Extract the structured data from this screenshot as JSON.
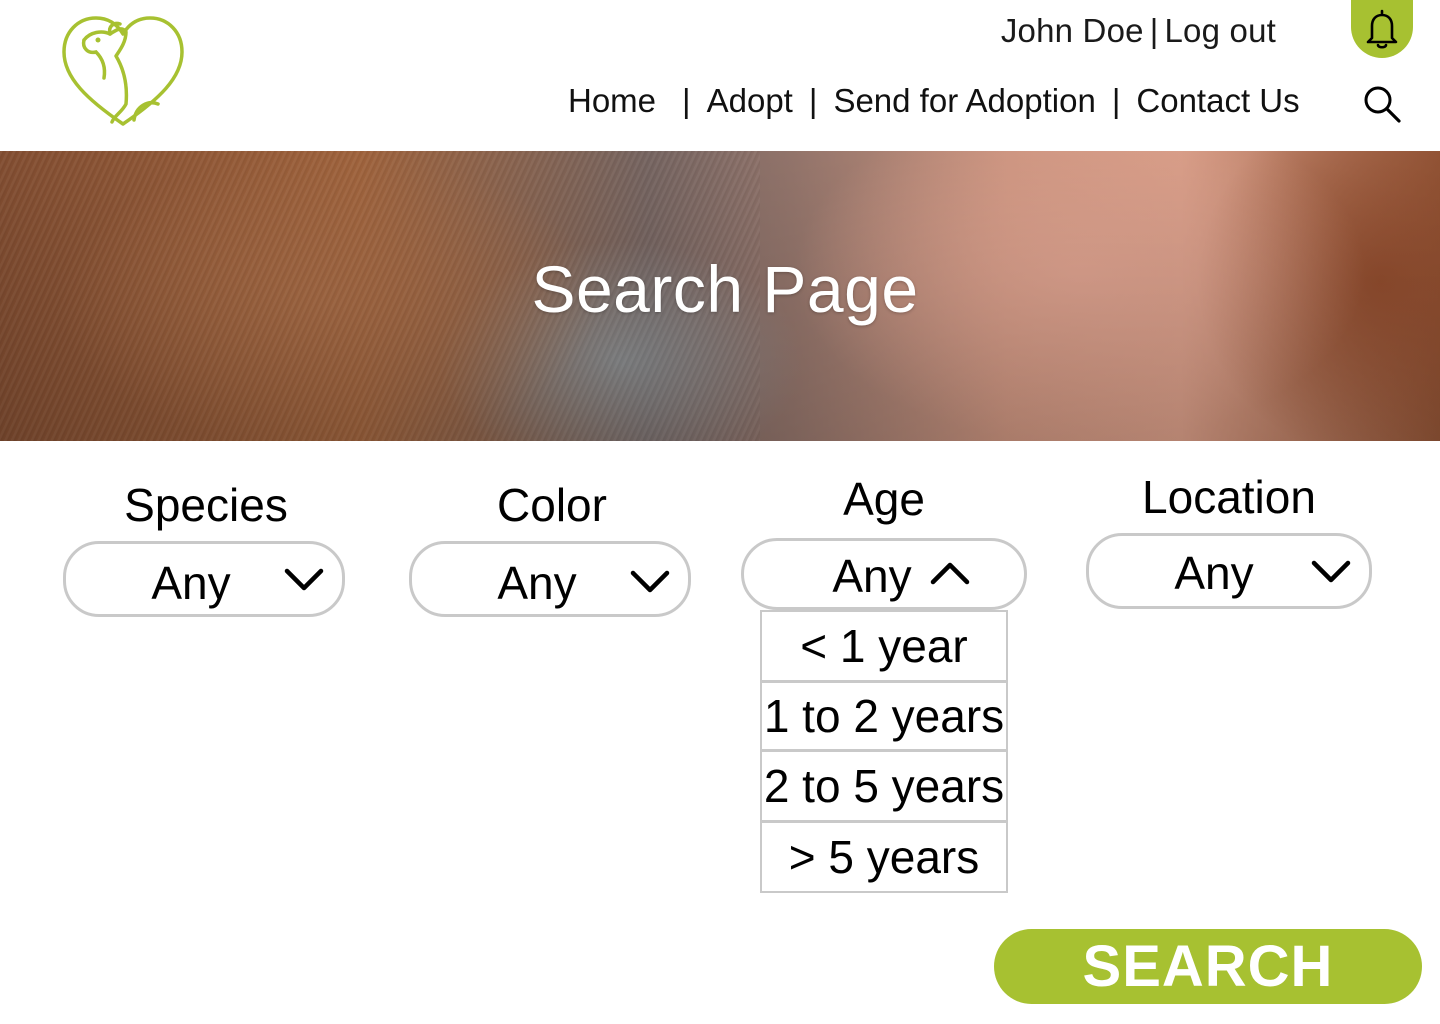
{
  "brand": {
    "logo_icon": "dog-cat-heart-logo-icon",
    "accent_color": "#a7c131",
    "border_color": "#c9c9c9"
  },
  "header": {
    "user_name": "John Doe",
    "separator": "|",
    "logout_label": "Log out",
    "notification_icon": "bell-icon",
    "search_icon": "search-icon"
  },
  "nav": {
    "items": [
      {
        "label": "Home"
      },
      {
        "label": "Adopt"
      },
      {
        "label": "Send for Adoption"
      },
      {
        "label": "Contact Us"
      }
    ],
    "separator": "|"
  },
  "hero": {
    "title": "Search Page"
  },
  "filters": {
    "species": {
      "label": "Species",
      "value": "Any",
      "state": "collapsed"
    },
    "color": {
      "label": "Color",
      "value": "Any",
      "state": "collapsed"
    },
    "age": {
      "label": "Age",
      "value": "Any",
      "state": "expanded",
      "options": [
        "< 1 year",
        "1 to 2 years",
        "2 to 5 years",
        "> 5 years"
      ]
    },
    "location": {
      "label": "Location",
      "value": "Any",
      "state": "collapsed"
    }
  },
  "search_button": {
    "label": "SEARCH"
  }
}
